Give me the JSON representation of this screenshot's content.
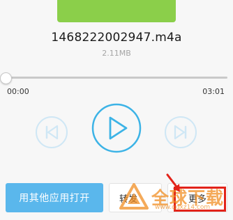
{
  "colors": {
    "cover": "#8bcf4a",
    "accent": "#3cb3e6",
    "secondary_controls": "#cfe7f5",
    "open_button": "#5ab7ec",
    "highlight": "#e2231a",
    "watermark": "#f08a1c"
  },
  "player": {
    "file_name": "1468222002947.m4a",
    "file_size": "2.11MB",
    "current_time": "00:00",
    "total_time": "03:01",
    "progress": 0
  },
  "icons": {
    "prev": "skip-previous-icon",
    "play": "play-icon",
    "next": "skip-next-icon"
  },
  "actions": {
    "open_with": "用其他应用打开",
    "share": "转发",
    "more": "更多"
  },
  "watermark": {
    "text": "全球下载",
    "url": "www.qqxz14.com"
  }
}
